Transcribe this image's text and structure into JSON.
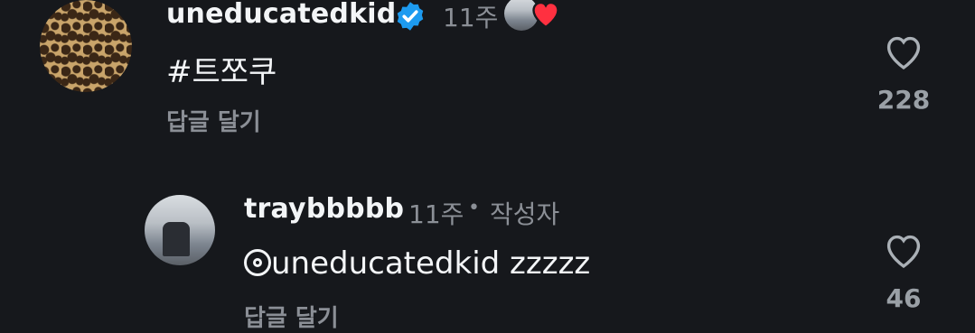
{
  "comments": [
    {
      "username": "uneducatedkid",
      "verified": true,
      "time": "11주",
      "text": "#트쪼쿠",
      "reply_label": "답글 달기",
      "likes": "228",
      "liked_by_author": true
    },
    {
      "username": "traybbbbb",
      "time": "11주",
      "separator": "•",
      "author_badge": "작성자",
      "mention": "uneducatedkid",
      "text": "zzzzz",
      "reply_label": "답글 달기",
      "likes": "46"
    }
  ],
  "colors": {
    "background": "#16181c",
    "verified_blue": "#1d9bf0",
    "heart_red": "#ff3040",
    "muted_text": "#8b8f96"
  }
}
